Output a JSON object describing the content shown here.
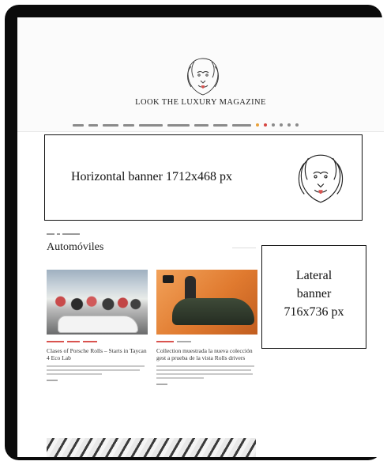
{
  "header": {
    "masthead": "LOOK THE LUXURY MAGAZINE",
    "logo_icon": "lion-head-icon",
    "nav_items": 9,
    "colors": {
      "accent": "#d9534f",
      "icon_orange": "#e9a23b"
    }
  },
  "banners": {
    "horizontal": "Horizontal banner 1712x468 px",
    "lateral_line1": "Lateral",
    "lateral_line2": "banner",
    "lateral_line3": "716x736 px"
  },
  "section": {
    "title": "Automóviles"
  },
  "cards": [
    {
      "title": "Clases of Porsche Rolls – Starts in Taycan 4 Eco Lab"
    },
    {
      "title": "Collection muestrada la nueva colección gest a prueba de la vista Rolls drivers"
    }
  ]
}
